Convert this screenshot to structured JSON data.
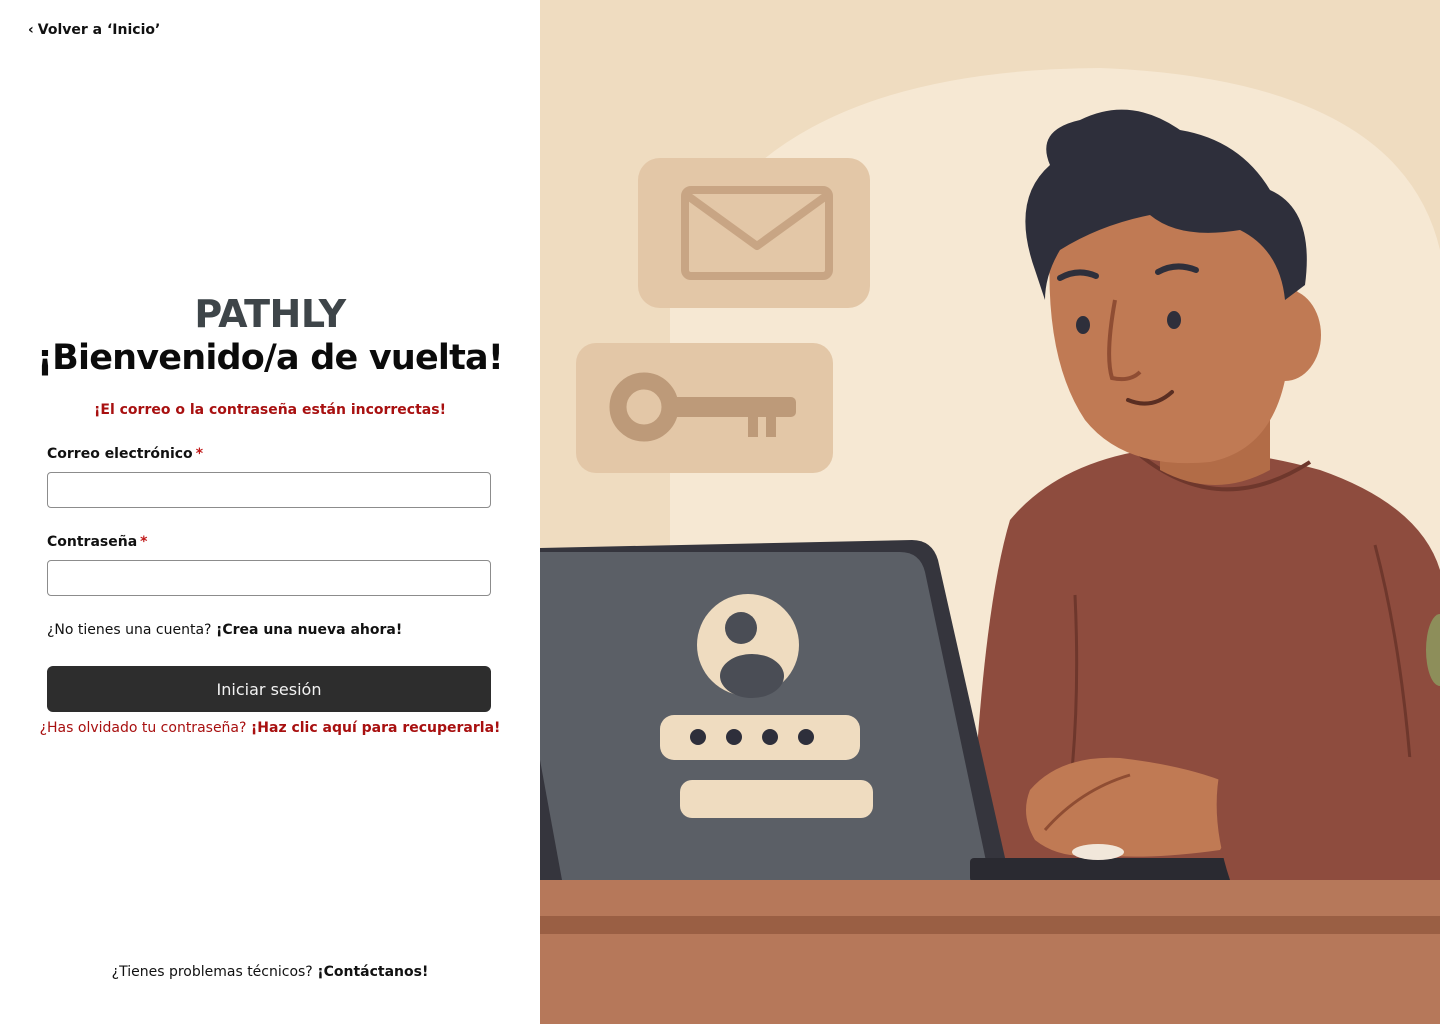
{
  "back_link": {
    "label": "Volver a ‘Inicio’"
  },
  "brand": {
    "name": "PATHLY"
  },
  "headline": "¡Bienvenido/a de vuelta!",
  "error_message": "¡El correo o la contraseña están incorrectas!",
  "form": {
    "email": {
      "label": "Correo electrónico",
      "required_mark": "*",
      "value": "",
      "placeholder": ""
    },
    "password": {
      "label": "Contraseña",
      "required_mark": "*",
      "value": "",
      "placeholder": ""
    }
  },
  "signup": {
    "prompt": "¿No tienes una cuenta?",
    "cta": "¡Crea una nueva ahora!"
  },
  "login_button": {
    "label": "Iniciar sesión"
  },
  "forgot": {
    "prompt": "¿Has olvidado tu contraseña?",
    "cta": "¡Haz clic aquí para recuperarla!"
  },
  "support": {
    "prompt": "¿Tienes problemas técnicos?",
    "cta": "¡Contáctanos!"
  },
  "colors": {
    "error_red": "#a81010",
    "button_dark": "#2d2d2d",
    "brand_gray": "#3e4549",
    "illustration_bg": "#f0dfc4",
    "shirt": "#8e4c3e",
    "skin": "#c07a54",
    "laptop": "#5b5f66"
  },
  "illustration": {
    "icons": [
      "envelope-icon",
      "key-icon",
      "user-avatar-icon"
    ],
    "password_mask": "••••"
  }
}
